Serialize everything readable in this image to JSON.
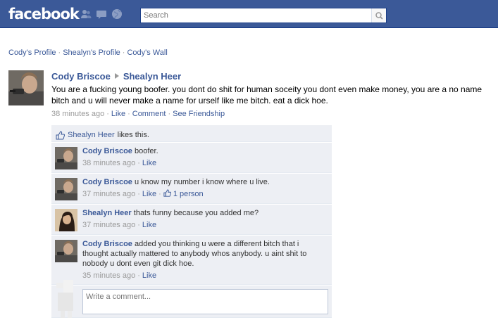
{
  "header": {
    "logo": "facebook",
    "search_placeholder": "Search"
  },
  "breadcrumb": [
    {
      "label": "Cody's Profile"
    },
    {
      "label": "Shealyn's Profile"
    },
    {
      "label": "Cody's Wall"
    }
  ],
  "story": {
    "author": "Cody Briscoe",
    "target": "Shealyn Heer",
    "message": "You are a fucking young boofer. you dont do shit for human soceity you dont even make money, you are a no name bitch and u will never make a name for urself like me bitch. eat a dick hoe.",
    "time": "38 minutes ago",
    "actions": {
      "like": "Like",
      "comment": "Comment",
      "see_friendship": "See Friendship"
    }
  },
  "likes": {
    "name": "Shealyn Heer",
    "suffix": "likes this."
  },
  "comments": [
    {
      "author": "Cody Briscoe",
      "text": "boofer.",
      "time": "38 minutes ago",
      "like": "Like",
      "likes_count": ""
    },
    {
      "author": "Cody Briscoe",
      "text": "u know my number i know where u live.",
      "time": "37 minutes ago",
      "like": "Like",
      "likes_count": "1 person"
    },
    {
      "author": "Shealyn Heer",
      "text": "thats funny because you added me?",
      "time": "37 minutes ago",
      "like": "Like",
      "likes_count": ""
    },
    {
      "author": "Cody Briscoe",
      "text": "added you thinking u were a different bitch that i thought actually mattered to anybody whos anybody. u aint shit to nobody u dont even git dick hoe.",
      "time": "35 minutes ago",
      "like": "Like",
      "likes_count": ""
    }
  ],
  "write_comment": {
    "placeholder": "Write a comment..."
  },
  "colors": {
    "brand": "#3b5998",
    "ufi_bg": "#edeff4",
    "meta": "#999999"
  }
}
